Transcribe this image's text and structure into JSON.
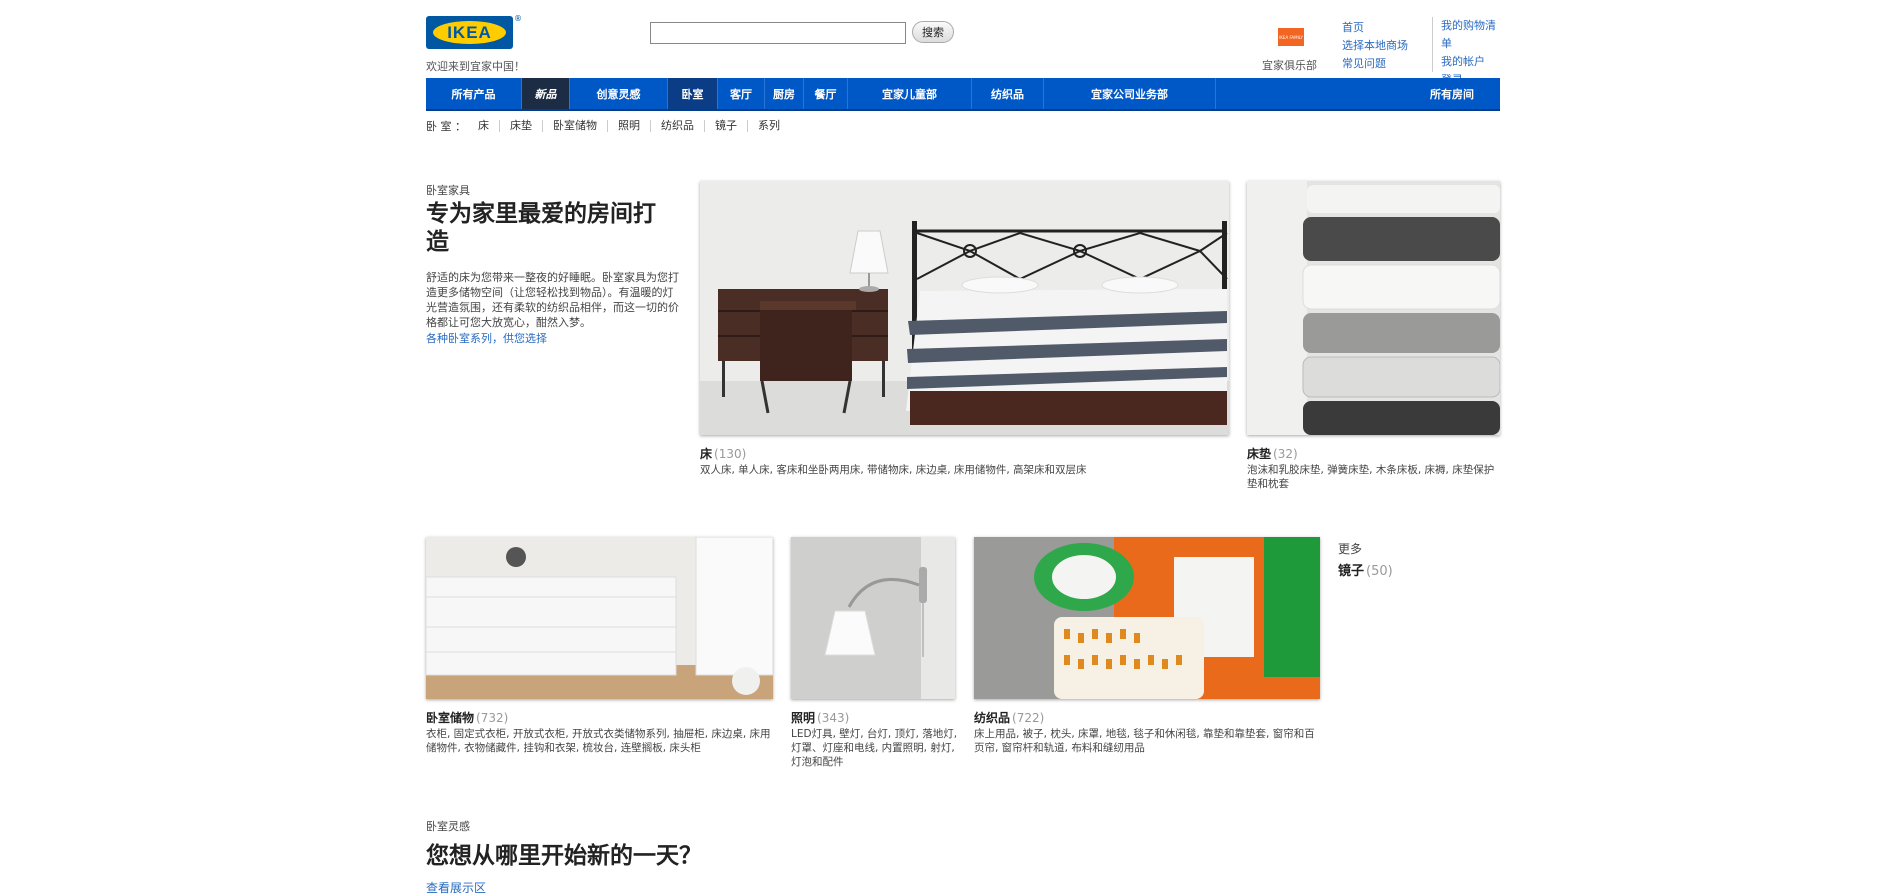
{
  "header": {
    "logo_text": "IKEA",
    "logo_reg": "®",
    "welcome": "欢迎来到宜家中国！",
    "search": {
      "value": "",
      "button_label": "搜索"
    },
    "family_card_text": "IKEA FAMILY",
    "family_label": "宜家俱乐部",
    "links_col1": [
      "首页",
      "选择本地商场",
      "常见问题"
    ],
    "links_col2": [
      "我的购物清单",
      "我的帐户",
      "登录"
    ]
  },
  "nav": {
    "items": [
      "所有产品",
      "新品",
      "创意灵感",
      "卧室",
      "客厅",
      "厨房",
      "餐厅",
      "宜家儿童部",
      "纺织品",
      "宜家公司业务部",
      "所有房间"
    ]
  },
  "subnav": {
    "title": "卧 室 ：",
    "items": [
      "床",
      "床垫",
      "卧室储物",
      "照明",
      "纺织品",
      "镜子",
      "系列"
    ]
  },
  "hero": {
    "eyebrow": "卧室家具",
    "title": "专为家里最爱的房间打造",
    "description": "舒适的床为您带来一整夜的好睡眠。卧室家具为您打造更多储物空间（让您轻松找到物品）。有温暖的灯光营造氛围，还有柔软的纺织品相伴，而这一切的价格都让可您大放宽心，酣然入梦。",
    "link": "各种卧室系列，供您选择"
  },
  "tiles": {
    "beds": {
      "title": "床",
      "count": "(130)",
      "desc": "双人床, 单人床, 客床和坐卧两用床, 带储物床, 床边桌, 床用储物件, 高架床和双层床"
    },
    "mattresses": {
      "title": "床垫",
      "count": "(32)",
      "desc": "泡沫和乳胶床垫, 弹簧床垫, 木条床板, 床褥, 床垫保护垫和枕套"
    },
    "storage": {
      "title": "卧室储物",
      "count": "(732)",
      "desc": "衣柜, 固定式衣柜, 开放式衣柜, 开放式衣类储物系列, 抽屉柜, 床边桌, 床用储物件, 衣物储藏件, 挂钩和衣架, 梳妆台, 连壁搁板, 床头柜"
    },
    "lighting": {
      "title": "照明",
      "count": "(343)",
      "desc": "LED灯具, 壁灯, 台灯, 顶灯, 落地灯, 灯罩、灯座和电线, 内置照明, 射灯, 灯泡和配件"
    },
    "textiles": {
      "title": "纺织品",
      "count": "(722)",
      "desc": "床上用品, 被子, 枕头, 床罩, 地毯, 毯子和休闲毯, 靠垫和靠垫套, 窗帘和百页帘, 窗帘杆和轨道, 布料和缝纫用品"
    }
  },
  "more": {
    "label": "更多",
    "title": "镜子",
    "count": "(50)"
  },
  "inspiration": {
    "eyebrow": "卧室灵感",
    "title": "您想从哪里开始新的一天？",
    "link": "查看展示区"
  },
  "colors": {
    "nav_blue": "#0058c6",
    "link_blue": "#2a6bc0",
    "logo_yellow": "#ffcc00",
    "logo_blue": "#0058a3"
  }
}
